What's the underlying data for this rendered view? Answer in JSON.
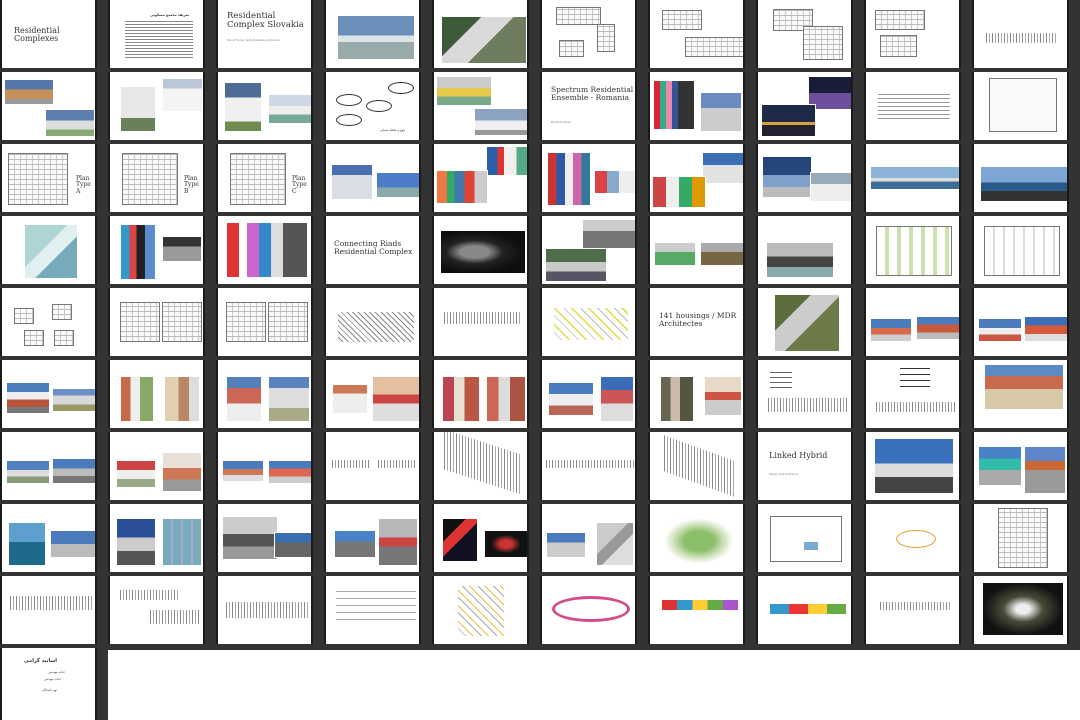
{
  "slides": {
    "s1_title": "Residential Complexes",
    "s3_title": "Residential Complex Slovakia",
    "s3_sub": "Mond Timber Hoffe Kabinetta Architects",
    "s16_title": "Spectrum Residential Ensemble - Romania",
    "s16_sub": "BA-DLS Studio",
    "s21_plan": "Plan Type A",
    "s22_plan": "Plan Type B",
    "s23_plan": "Plan Type C",
    "s34_title": "Connecting Riads Residential Complex",
    "s46_title": "141 housings / MDR Architectes",
    "s67_title": "Linked Hybrid",
    "s67_sub": "Steven Holl Architects",
    "s2_heading": "تعریف مجتمع مسکونی",
    "s14_text": "تنوع و تفکیک فضایی",
    "last_title": "اساتید گرامی",
    "last_line1": "جناب مهندس",
    "last_line2": "جناب مهندس",
    "last_line3": "تهیه کنندگان"
  },
  "accent": "#3a6fa8"
}
